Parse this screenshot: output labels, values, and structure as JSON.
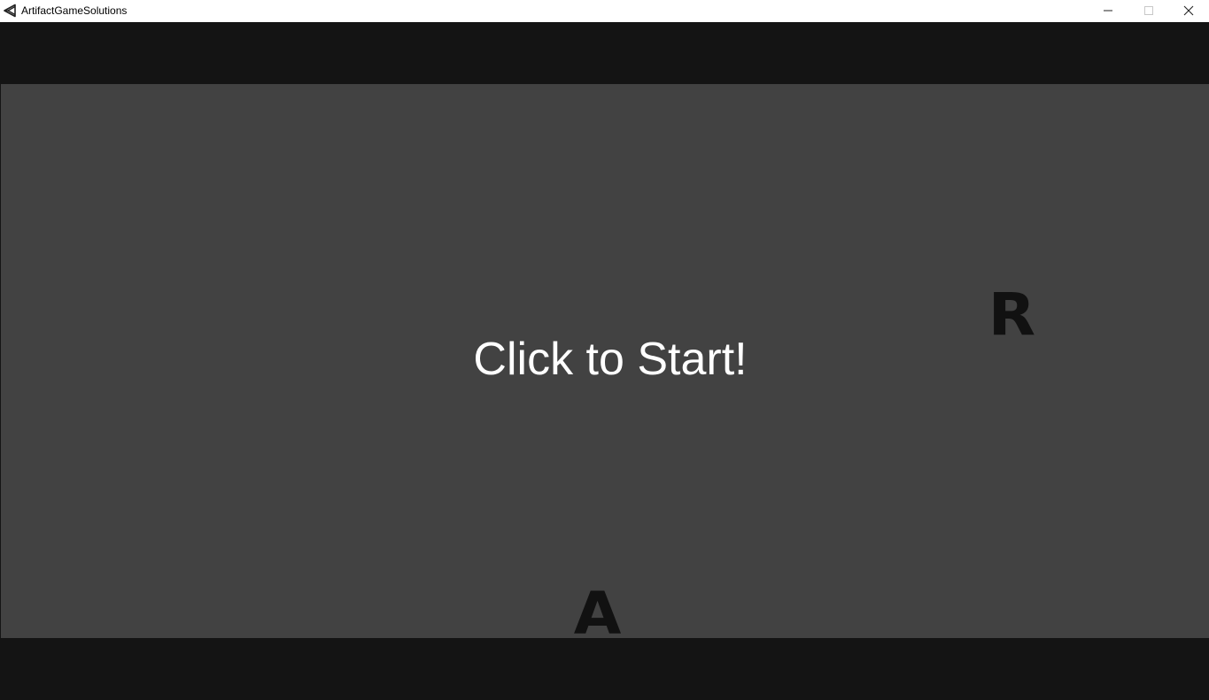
{
  "window": {
    "title": "ArtifactGameSolutions",
    "icon": "unity-icon",
    "controls": {
      "minimize_icon": "minimize-icon",
      "maximize_icon": "maximize-icon",
      "close_icon": "close-icon"
    }
  },
  "game": {
    "start_prompt": "Click to Start!",
    "letters": {
      "r": "R",
      "a": "A"
    }
  },
  "colors": {
    "letterbox": "#141414",
    "background": "#424242",
    "prompt_text": "#ffffff",
    "letter": "#111111"
  }
}
